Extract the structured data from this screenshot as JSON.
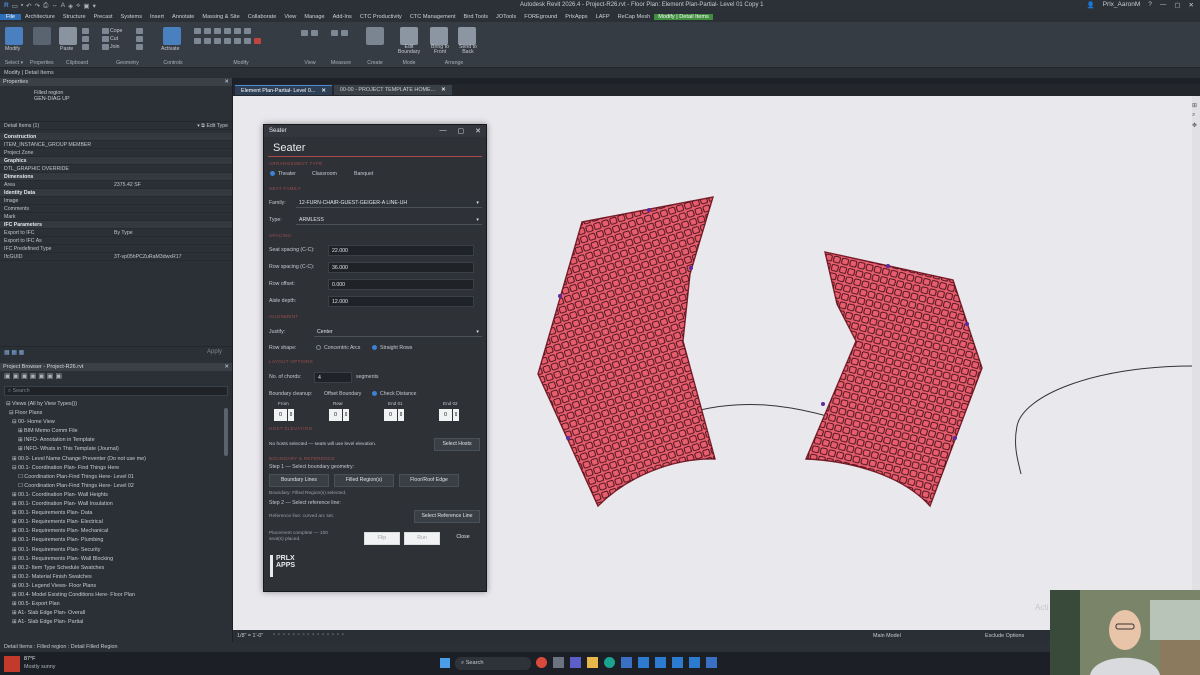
{
  "window": {
    "title": "Autodesk Revit 2026.4 - Project-R26.rvt - Floor Plan: Element Plan-Partial- Level 01 Copy 1",
    "user": "Prlx_AaronM"
  },
  "ribbon_tabs": [
    "File",
    "Architecture",
    "Structure",
    "Precast",
    "Systems",
    "Insert",
    "Annotate",
    "Massing & Site",
    "Collaborate",
    "View",
    "Manage",
    "Add-Ins",
    "CTC Productivity",
    "CTC Management",
    "Bird Tools",
    "JOTools",
    "FOREground",
    "PrlxApps",
    "LAFP",
    "ReCap Mesh",
    "Modify | Detail Items"
  ],
  "ribbon": {
    "modify": "Modify",
    "paste": "Paste",
    "cope": "Cope",
    "cut": "Cut",
    "join": "Join",
    "activate": "Activate",
    "edit_boundary": "Edit Boundary",
    "bring_to_front": "Bring to Front",
    "send_to_back": "Send to Back",
    "groups": [
      "Select ▾",
      "Properties",
      "Clipboard",
      "Geometry",
      "Controls",
      "Modify",
      "View",
      "Measure",
      "Create",
      "Mode",
      "Arrange"
    ]
  },
  "context_bar": "Modify | Detail Items",
  "properties": {
    "header": "Properties",
    "type_name": "Filled region",
    "type_sub": "GEN-DIAG UP",
    "selector": "Detail Items (1)",
    "edit_type": "Edit Type",
    "rows": [
      {
        "k": "Construction",
        "v": "",
        "hdr": true
      },
      {
        "k": "ITEM_INSTANCE_GROUP MEMBER",
        "v": ""
      },
      {
        "k": "Project Zone",
        "v": ""
      },
      {
        "k": "Graphics",
        "v": "",
        "hdr": true
      },
      {
        "k": "DTL_GRAPHIC OVERRIDE",
        "v": ""
      },
      {
        "k": "Dimensions",
        "v": "",
        "hdr": true
      },
      {
        "k": "Area",
        "v": "2375.42 SF"
      },
      {
        "k": "Identity Data",
        "v": "",
        "hdr": true
      },
      {
        "k": "Image",
        "v": ""
      },
      {
        "k": "Comments",
        "v": ""
      },
      {
        "k": "Mark",
        "v": ""
      },
      {
        "k": "IFC Parameters",
        "v": "",
        "hdr": true
      },
      {
        "k": "Export to IFC",
        "v": "By Type"
      },
      {
        "k": "Export to IFC As",
        "v": ""
      },
      {
        "k": "IFC Predefined Type",
        "v": ""
      },
      {
        "k": "IfcGUID",
        "v": "3T-vp05hPCZuRaM3dwxR17"
      }
    ],
    "apply": "Apply"
  },
  "project_browser": {
    "header": "Project Browser - Project-R26.rvt",
    "search_placeholder": "Search",
    "items": [
      "⊟ Views (All by View Types())",
      "  ⊟ Floor Plans",
      "    ⊟ 00- Home View",
      "        ⊞ BIM Memo Comm File",
      "        ⊞ INFO- Annotation in Template",
      "        ⊞ INFO- Whats in This Template (Journal)",
      "    ⊞ 00.0- Level Name Change Preventer (Do not use me)",
      "    ⊟ 00.1- Coordination Plan- Find Things Here",
      "        ☐ Coordination Plan-Find Things Here- Level 01",
      "        ☐ Coordination Plan-Find Things Here- Level 02",
      "    ⊞ 00.1- Coordination Plan- Wall Heights",
      "    ⊞ 00.1- Coordination Plan- Wall Insulation",
      "    ⊞ 00.1- Requirements Plan- Data",
      "    ⊞ 00.1- Requirements Plan- Electrical",
      "    ⊞ 00.1- Requirements Plan- Mechanical",
      "    ⊞ 00.1- Requirements Plan- Plumbing",
      "    ⊞ 00.1- Requirements Plan- Security",
      "    ⊞ 00.1- Requirements Plan- Wall Blocking",
      "    ⊞ 00.2- Item Type Schedule Swatches",
      "    ⊞ 00.2- Material Finish Swatches",
      "    ⊞ 00.3- Legend Views- Floor Plans",
      "    ⊞ 00.4- Model Existing Conditions Here- Floor Plan",
      "    ⊞ 00.5- Export Plan",
      "    ⊞ A1- Slab Edge Plan- Overall",
      "    ⊞ A1- Slab Edge Plan- Partial"
    ]
  },
  "view_tabs": [
    {
      "label": "Element Plan-Partial- Level 0...",
      "active": true
    },
    {
      "label": "00-00 - PROJECT TEMPLATE HOME...",
      "active": false
    }
  ],
  "seater": {
    "window_title": "Seater",
    "heading": "Seater",
    "sec_arrangement": "ARRANGEMENT TYPE",
    "arrangement_options": [
      "Theater",
      "Classroom",
      "Banquet"
    ],
    "arrangement_selected": "Theater",
    "sec_seat_family": "SEAT FAMILY",
    "family_label": "Family:",
    "family_value": "12-FURN-CHAIR-GUEST-GEIGER-A LINE-UH",
    "type_label": "Type:",
    "type_value": "ARMLESS",
    "sec_spacing": "SPACING",
    "seat_spacing_label": "Seat spacing (C-C):",
    "seat_spacing_value": "22.000",
    "row_spacing_label": "Row spacing (C-C):",
    "row_spacing_value": "36.000",
    "row_offset_label": "Row offset:",
    "row_offset_value": "0.000",
    "aisle_depth_label": "Aisle depth:",
    "aisle_depth_value": "12.000",
    "sec_alignment": "ALIGNMENT",
    "justify_label": "Justify:",
    "justify_value": "Center",
    "row_shape_label": "Row shape:",
    "row_shape_options": [
      "Concentric Arcs",
      "Straight Rows"
    ],
    "row_shape_selected": "Straight Rows",
    "sec_layout": "LAYOUT OPTIONS",
    "chords_label": "No. of chords:",
    "chords_value": "4",
    "chords_unit": "segments",
    "boundary_cleanup_label": "Boundary cleanup:",
    "offset_boundary": "Offset Boundary",
    "check_distance": "Check Distance",
    "step_labels": [
      "From",
      "Rear",
      "End 01",
      "End 02"
    ],
    "step_values": [
      "0",
      "0",
      "0",
      "0"
    ],
    "sec_host": "HOST ELEVATION",
    "host_text": "No hosts selected — seats will use level elevation.",
    "select_hosts": "Select Hosts",
    "sec_boundary": "BOUNDARY & REFERENCE",
    "step1": "Step 1 — Select boundary geometry:",
    "boundary_lines": "Boundary Lines",
    "filled_regions": "Filled Region(s)",
    "floor_roof_edge": "Floor/Roof Edge",
    "boundary_status": "Boundary: Filled Region(s) selected.",
    "step2": "Step 2 — Select reference line:",
    "reference_status": "Reference line: curved arc set.",
    "select_reference": "Select Reference Line",
    "placement_status": "Placement complete — 100 seat(s) placed.",
    "flip": "Flip",
    "run": "Run",
    "close": "Close",
    "logo_line1": "PRLX",
    "logo_line2": "APPS"
  },
  "canvas_bar": {
    "scale": "1/8\" = 1'-0\"",
    "model": "Main Model",
    "exclude": "Exclude Options"
  },
  "status_bar": "Detail Items : Filled region : Detail Filled Region",
  "taskbar": {
    "weather_temp": "87°F",
    "weather_desc": "Mostly sunny",
    "search": "Search"
  },
  "watermark": "Acti",
  "colors": {
    "region_fill": "#e85d6e",
    "region_stroke": "#7d1e2b",
    "accent": "#3b82d6",
    "active_tab": "#3f8f3f"
  }
}
